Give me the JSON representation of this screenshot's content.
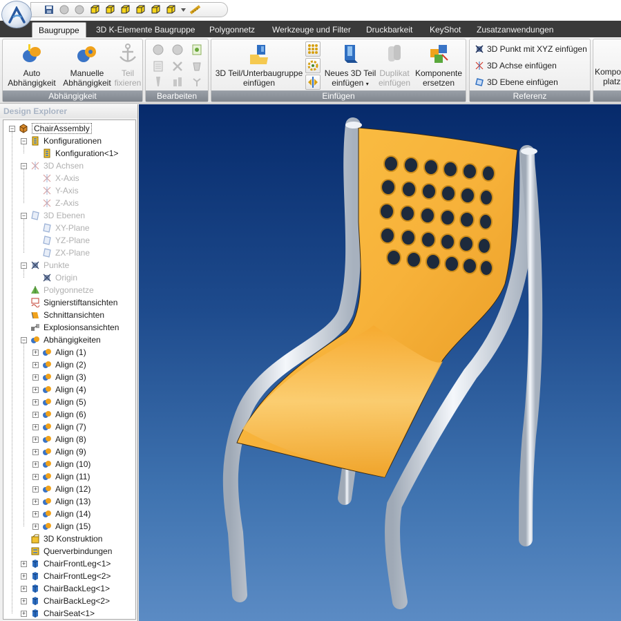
{
  "tabs": [
    "Baugruppe",
    "3D K-Elemente Baugruppe",
    "Polygonnetz",
    "Werkzeuge und Filter",
    "Druckbarkeit",
    "KeyShot",
    "Zusatzanwendungen"
  ],
  "active_tab": "Baugruppe",
  "ribbon": {
    "groups": {
      "abhaengigkeit": "Abhängigkeit",
      "bearbeiten": "Bearbeiten",
      "einfuegen": "Einfügen",
      "referenz": "Referenz"
    },
    "buttons": {
      "auto": [
        "Auto",
        "Abhängigkeit"
      ],
      "manuelle": [
        "Manuelle",
        "Abhängigkeit"
      ],
      "teil_fixieren": [
        "Teil",
        "fixieren"
      ],
      "teil_einfuegen": [
        "3D Teil/Unterbaugruppe",
        "einfügen"
      ],
      "neues_teil": [
        "Neues 3D Teil",
        "einfügen"
      ],
      "duplikat": [
        "Duplikat",
        "einfügen"
      ],
      "komponente": [
        "Komponente",
        "ersetzen"
      ],
      "komponente_platz": [
        "Kompo",
        "platz"
      ]
    },
    "referenz_items": [
      "3D Punkt mit XYZ einfügen",
      "3D Achse einfügen",
      "3D Ebene einfügen"
    ]
  },
  "explorer": {
    "title": "Design Explorer",
    "nodes": [
      {
        "label": "ChairAssembly",
        "icon": "assembly-icon"
      },
      {
        "label": "Konfigurationen",
        "icon": "config-icon"
      },
      {
        "label": "Konfiguration<1>",
        "icon": "config-icon"
      },
      {
        "label": "3D Achsen",
        "icon": "axis-icon"
      },
      {
        "label": "X-Axis",
        "icon": "axis-icon"
      },
      {
        "label": "Y-Axis",
        "icon": "axis-icon"
      },
      {
        "label": "Z-Axis",
        "icon": "axis-icon"
      },
      {
        "label": "3D Ebenen",
        "icon": "plane-icon"
      },
      {
        "label": "XY-Plane",
        "icon": "plane-icon"
      },
      {
        "label": "YZ-Plane",
        "icon": "plane-icon"
      },
      {
        "label": "ZX-Plane",
        "icon": "plane-icon"
      },
      {
        "label": "Punkte",
        "icon": "point-icon"
      },
      {
        "label": "Origin",
        "icon": "point-icon"
      },
      {
        "label": "Polygonnetze",
        "icon": "mesh-icon"
      },
      {
        "label": "Signierstiftansichten",
        "icon": "pen-view-icon"
      },
      {
        "label": "Schnittansichten",
        "icon": "section-view-icon"
      },
      {
        "label": "Explosionsansichten",
        "icon": "explode-view-icon"
      },
      {
        "label": "Abhängigkeiten",
        "icon": "constraint-icon"
      },
      {
        "label": "Align (1)",
        "icon": "constraint-icon"
      },
      {
        "label": "Align (2)",
        "icon": "constraint-icon"
      },
      {
        "label": "Align (3)",
        "icon": "constraint-icon"
      },
      {
        "label": "Align (4)",
        "icon": "constraint-icon"
      },
      {
        "label": "Align (5)",
        "icon": "constraint-icon"
      },
      {
        "label": "Align (6)",
        "icon": "constraint-icon"
      },
      {
        "label": "Align (7)",
        "icon": "constraint-icon"
      },
      {
        "label": "Align (8)",
        "icon": "constraint-icon"
      },
      {
        "label": "Align (9)",
        "icon": "constraint-icon"
      },
      {
        "label": "Align (10)",
        "icon": "constraint-icon"
      },
      {
        "label": "Align (11)",
        "icon": "constraint-icon"
      },
      {
        "label": "Align (12)",
        "icon": "constraint-icon"
      },
      {
        "label": "Align (13)",
        "icon": "constraint-icon"
      },
      {
        "label": "Align (14)",
        "icon": "constraint-icon"
      },
      {
        "label": "Align (15)",
        "icon": "constraint-icon"
      },
      {
        "label": "3D Konstruktion",
        "icon": "construction-icon"
      },
      {
        "label": "Querverbindungen",
        "icon": "crosslink-icon"
      },
      {
        "label": "ChairFrontLeg<1>",
        "icon": "part-icon"
      },
      {
        "label": "ChairFrontLeg<2>",
        "icon": "part-icon"
      },
      {
        "label": "ChairBackLeg<1>",
        "icon": "part-icon"
      },
      {
        "label": "ChairBackLeg<2>",
        "icon": "part-icon"
      },
      {
        "label": "ChairSeat<1>",
        "icon": "part-icon"
      }
    ]
  },
  "colors": {
    "tab_bar": "#3a3a3a",
    "group_label": "#8a9098",
    "viewport_top": "#062a6b",
    "viewport_bottom": "#5b8bc4",
    "chair_seat": "#f7b23a",
    "chair_frame": "#c9d2dc"
  }
}
